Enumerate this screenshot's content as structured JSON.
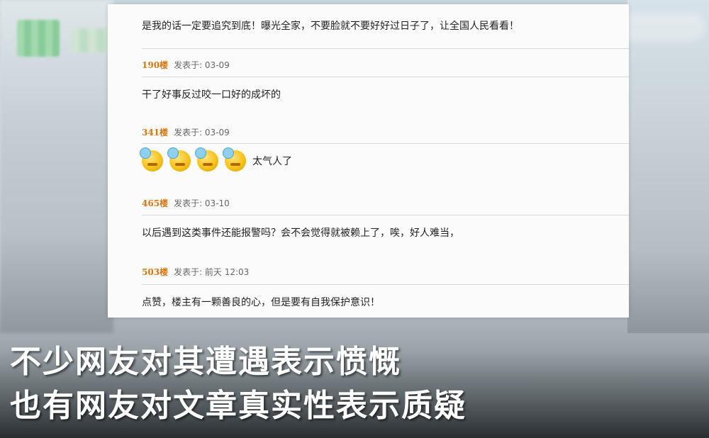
{
  "posts": [
    {
      "id": "p0",
      "text": "是我的话一定要追究到底！曝光全家，不要脸就不要好好过日子了，让全国人民看看！"
    },
    {
      "id": "p1",
      "floor": "190楼",
      "meta": "发表于: 03-09",
      "text": "干了好事反过咬一口好的成坏的"
    },
    {
      "id": "p2",
      "floor": "341楼",
      "meta": "发表于: 03-09",
      "text": "太气人了",
      "emoji_count": 4,
      "emoji_icon": "angry-face-icon"
    },
    {
      "id": "p3",
      "floor": "465楼",
      "meta": "发表于: 03-10",
      "text": "以后遇到这类事件还能报警吗？会不会觉得就被赖上了，唉，好人难当，"
    },
    {
      "id": "p4",
      "floor": "503楼",
      "meta": "发表于: 前天 12:03",
      "text": "点赞，楼主有一颗善良的心，但是要有自我保护意识！"
    }
  ],
  "subtitles": {
    "line1": "不少网友对其遭遇表示愤慨",
    "line2": "也有网友对文章真实性表示质疑"
  },
  "colors": {
    "floor": "#d8750b",
    "subtitle": "#ffffff"
  }
}
